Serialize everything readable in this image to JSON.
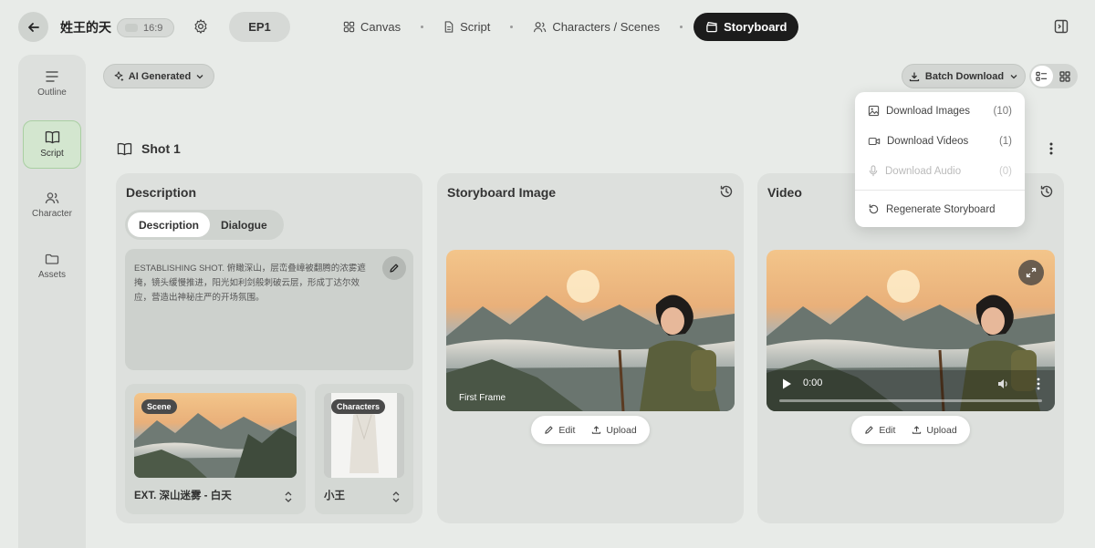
{
  "topbar": {
    "project_title": "姓王的天",
    "ratio": "16:9",
    "episode": "EP1",
    "tabs": [
      {
        "label": "Canvas",
        "icon": "grid-icon"
      },
      {
        "label": "Script",
        "icon": "document-icon"
      },
      {
        "label": "Characters / Scenes",
        "icon": "users-icon"
      },
      {
        "label": "Storyboard",
        "icon": "clapperboard-icon",
        "active": true
      }
    ]
  },
  "sidebar": {
    "items": [
      {
        "label": "Outline",
        "icon": "list-icon"
      },
      {
        "label": "Script",
        "icon": "book-icon",
        "active": true
      },
      {
        "label": "Character",
        "icon": "users-icon"
      },
      {
        "label": "Assets",
        "icon": "folder-icon"
      }
    ]
  },
  "toolbar": {
    "ai_filter": "AI Generated",
    "batch_download": "Batch Download"
  },
  "shot": {
    "title": "Shot 1"
  },
  "description_card": {
    "title": "Description",
    "seg_description": "Description",
    "seg_dialogue": "Dialogue",
    "text": "ESTABLISHING SHOT. 俯瞰深山，层峦叠嶂被翻腾的浓雾遮掩，镜头缓慢推进，阳光如利剑般刺破云层，形成丁达尔效应，营造出神秘庄严的开场氛围。",
    "scene_badge": "Scene",
    "scene_label": "EXT. 深山迷雾 - 白天",
    "characters_badge": "Characters",
    "character_label": "小王"
  },
  "storyboard_card": {
    "title": "Storyboard Image",
    "frame_label": "First Frame",
    "edit": "Edit",
    "upload": "Upload"
  },
  "video_card": {
    "title": "Video",
    "time": "0:00",
    "edit": "Edit",
    "upload": "Upload"
  },
  "dropdown": {
    "items": [
      {
        "label": "Download Images",
        "count": "(10)",
        "icon": "image-icon"
      },
      {
        "label": "Download Videos",
        "count": "(1)",
        "icon": "video-icon"
      },
      {
        "label": "Download Audio",
        "count": "(0)",
        "icon": "mic-icon",
        "disabled": true
      },
      {
        "label": "Regenerate Storyboard",
        "icon": "refresh-icon"
      }
    ]
  },
  "colors": {
    "background": "#e8ebe8",
    "active_tab": "#1c1c1c",
    "sidebar_active": "#d3e6cf"
  }
}
